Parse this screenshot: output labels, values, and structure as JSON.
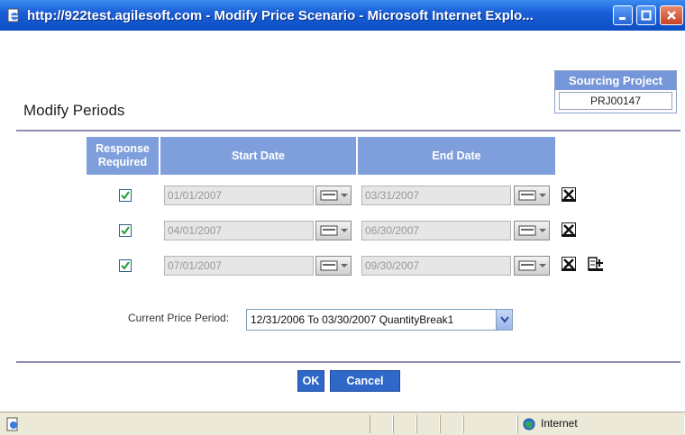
{
  "window": {
    "title": "http://922test.agilesoft.com - Modify Price Scenario - Microsoft Internet Explo..."
  },
  "sourcing_project": {
    "label": "Sourcing Project",
    "value": "PRJ00147"
  },
  "page_title": "Modify Periods",
  "table": {
    "headers": {
      "response_required": "Response Required",
      "start_date": "Start Date",
      "end_date": "End Date"
    },
    "rows": [
      {
        "checked": true,
        "start": "01/01/2007",
        "end": "03/31/2007"
      },
      {
        "checked": true,
        "start": "04/01/2007",
        "end": "06/30/2007"
      },
      {
        "checked": true,
        "start": "07/01/2007",
        "end": "09/30/2007"
      }
    ]
  },
  "current_price_period": {
    "label": "Current Price Period:",
    "value": "12/31/2006 To 03/30/2007 QuantityBreak1"
  },
  "buttons": {
    "ok": "OK",
    "cancel": "Cancel"
  },
  "statusbar": {
    "zone": "Internet"
  },
  "colors": {
    "titlebar": "#1a5fd8",
    "header_blue": "#7f9fdc",
    "button_blue": "#2f68c8"
  }
}
